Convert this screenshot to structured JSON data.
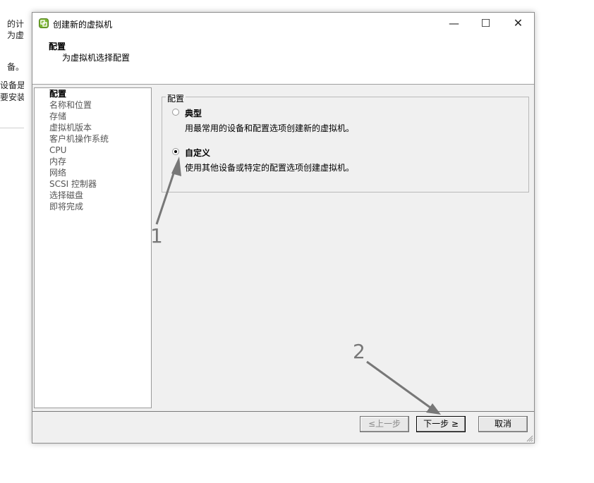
{
  "background_window": {
    "fragments": [
      "的计",
      "为虚",
      "备。",
      "设备是",
      "要安装"
    ]
  },
  "dialog": {
    "title": "创建新的虚拟机",
    "window_controls": {
      "minimize": "—",
      "maximize": "☐",
      "close": "✕"
    },
    "step_title": "配置",
    "step_subtitle": "为虚拟机选择配置"
  },
  "sidebar": {
    "items": [
      {
        "label": "配置",
        "current": true
      },
      {
        "label": "名称和位置"
      },
      {
        "label": "存储"
      },
      {
        "label": "虚拟机版本"
      },
      {
        "label": "客户机操作系统"
      },
      {
        "label": "CPU"
      },
      {
        "label": "内存"
      },
      {
        "label": "网络"
      },
      {
        "label": "SCSI 控制器"
      },
      {
        "label": "选择磁盘"
      },
      {
        "label": "即将完成"
      }
    ]
  },
  "config": {
    "group_label": "配置",
    "options": [
      {
        "label": "典型",
        "description": "用最常用的设备和配置选项创建新的虚拟机。",
        "selected": false
      },
      {
        "label": "自定义",
        "description": "使用其他设备或特定的配置选项创建虚拟机。",
        "selected": true
      }
    ]
  },
  "buttons": {
    "back": "≤上一步",
    "next": "下一步 ≥",
    "cancel": "取消"
  },
  "annotations": {
    "one": "1",
    "two": "2"
  },
  "colors": {
    "dialog_bg": "#f0f0f0",
    "annotation": "#777777",
    "app_icon": "#6ea82a"
  }
}
